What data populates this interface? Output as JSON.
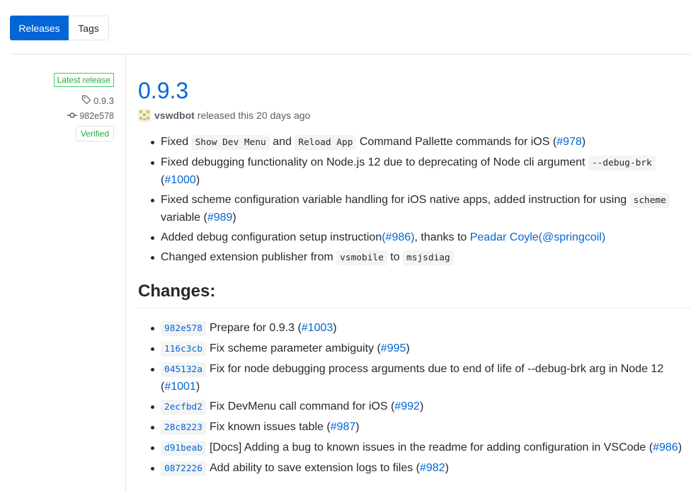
{
  "tabs": {
    "releases": "Releases",
    "tags": "Tags"
  },
  "meta": {
    "latest_badge": "Latest release",
    "tag": "0.9.3",
    "commit": "982e578",
    "verified": "Verified"
  },
  "release": {
    "title": "0.9.3",
    "author": "vswdbot",
    "released_text": "released this 20 days ago"
  },
  "notes": {
    "n1": {
      "a": "Fixed",
      "code1": "Show Dev Menu",
      "b": "and",
      "code2": "Reload App",
      "c": "Command Pallette commands for iOS (",
      "link": "#978",
      "d": ")"
    },
    "n2": {
      "a": "Fixed debugging functionality on Node.js 12 due to deprecating of Node cli argument",
      "code": "--debug-brk",
      "b": "(",
      "link": "#1000",
      "c": ")"
    },
    "n3": {
      "a": "Fixed scheme configuration variable handling for iOS native apps, added instruction for using",
      "code": "scheme",
      "b": "variable (",
      "link": "#989",
      "c": ")"
    },
    "n4": {
      "a": "Added debug configuration setup instruction",
      "link1": "(#986)",
      "b": ", thanks to ",
      "link2": "Peadar Coyle(@springcoil)"
    },
    "n5": {
      "a": "Changed extension publisher from",
      "code1": "vsmobile",
      "b": "to",
      "code2": "msjsdiag"
    }
  },
  "changes_heading": "Changes:",
  "changes": [
    {
      "sha": "982e578",
      "text": "Prepare for 0.9.3 (",
      "link": "#1003",
      "end": ")"
    },
    {
      "sha": "116c3cb",
      "text": "Fix scheme parameter ambiguity (",
      "link": "#995",
      "end": ")"
    },
    {
      "sha": "045132a",
      "text": "Fix for node debugging process arguments due to end of life of --debug-brk arg in Node 12 (",
      "link": "#1001",
      "end": ")"
    },
    {
      "sha": "2ecfbd2",
      "text": "Fix DevMenu call command for iOS (",
      "link": "#992",
      "end": ")"
    },
    {
      "sha": "28c8223",
      "text": "Fix known issues table (",
      "link": "#987",
      "end": ")"
    },
    {
      "sha": "d91beab",
      "text": "[Docs] Adding a bug to known issues in the readme for adding configuration in VSCode (",
      "link": "#986",
      "end": ")"
    },
    {
      "sha": "0872226",
      "text": "Add ability to save extension logs to files (",
      "link": "#982",
      "end": ")"
    }
  ],
  "colors": {
    "accent": "#0366d6",
    "success": "#28a745",
    "text": "#24292e",
    "muted": "#586069"
  },
  "icons": {
    "tag": "tag-icon",
    "commit": "git-commit-icon",
    "avatar": "avatar-icon"
  }
}
